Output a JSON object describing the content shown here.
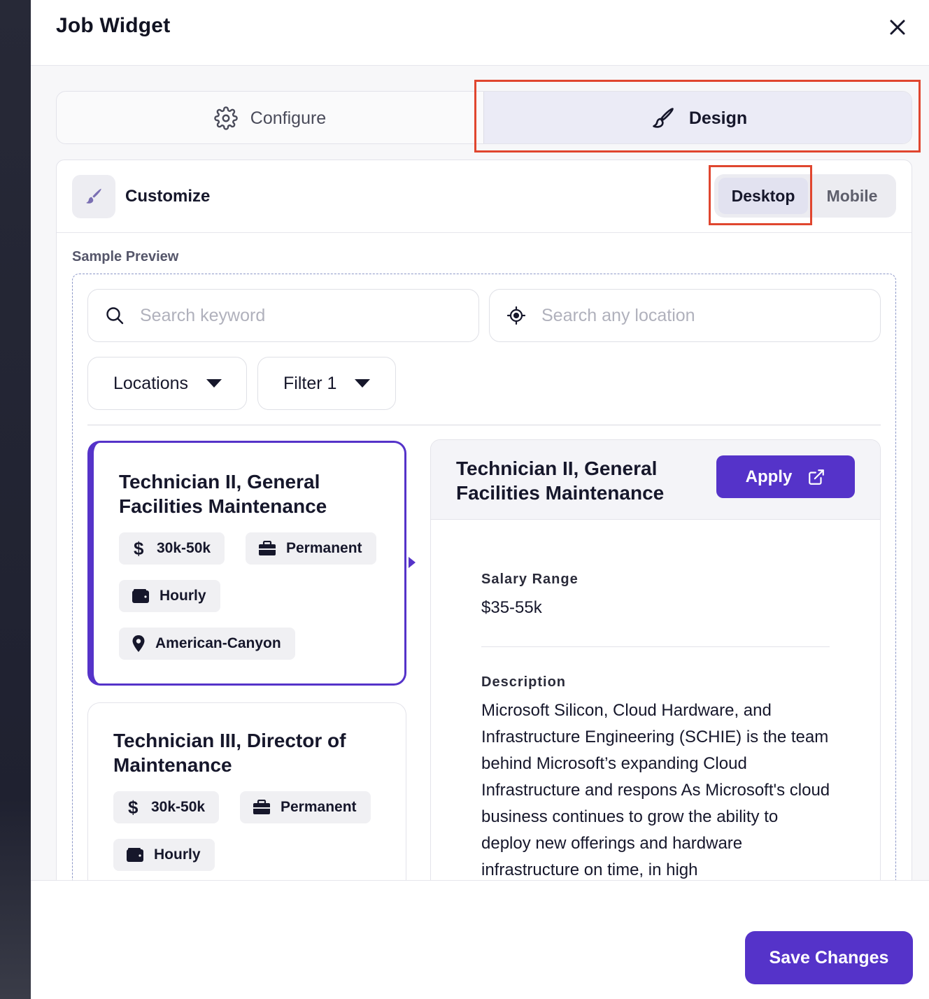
{
  "dialog": {
    "title": "Job Widget"
  },
  "tabs": [
    {
      "label": "Configure",
      "icon": "gear-icon",
      "active": false
    },
    {
      "label": "Design",
      "icon": "paintbrush-icon",
      "active": true
    }
  ],
  "customize": {
    "label": "Customize",
    "icon": "paintbrush-icon",
    "view_toggle": {
      "options": [
        "Desktop",
        "Mobile"
      ],
      "selected": "Desktop"
    }
  },
  "preview": {
    "label": "Sample Preview",
    "search_keyword": {
      "placeholder": "Search keyword",
      "icon": "search-icon"
    },
    "search_location": {
      "placeholder": "Search any location",
      "icon": "crosshair-icon"
    },
    "filters": [
      "Locations",
      "Filter 1"
    ],
    "jobs": [
      {
        "title": "Technician II, General Facilities Maintenance",
        "salary": "30k-50k",
        "type": "Permanent",
        "pay": "Hourly",
        "location": "American-Canyon",
        "selected": true
      },
      {
        "title": "Technician III, Director of Maintenance",
        "salary": "30k-50k",
        "type": "Permanent",
        "pay": "Hourly",
        "selected": false
      }
    ],
    "detail": {
      "title": "Technician II, General Facilities Maintenance",
      "apply_label": "Apply",
      "salary_label": "Salary Range",
      "salary_value": "$35-55k",
      "description_label": "Description",
      "description": "Microsoft Silicon, Cloud Hardware, and Infrastructure Engineering (SCHIE) is the team behind Microsoft’s expanding Cloud Infrastructure and respons As Microsoft's cloud business continues to grow the ability to deploy new offerings and hardware infrastructure on time, in high"
    }
  },
  "footer": {
    "save_label": "Save Changes"
  },
  "colors": {
    "accent": "#5533c9",
    "highlight": "#e0462f",
    "tab_active_bg": "#ebebf6"
  }
}
